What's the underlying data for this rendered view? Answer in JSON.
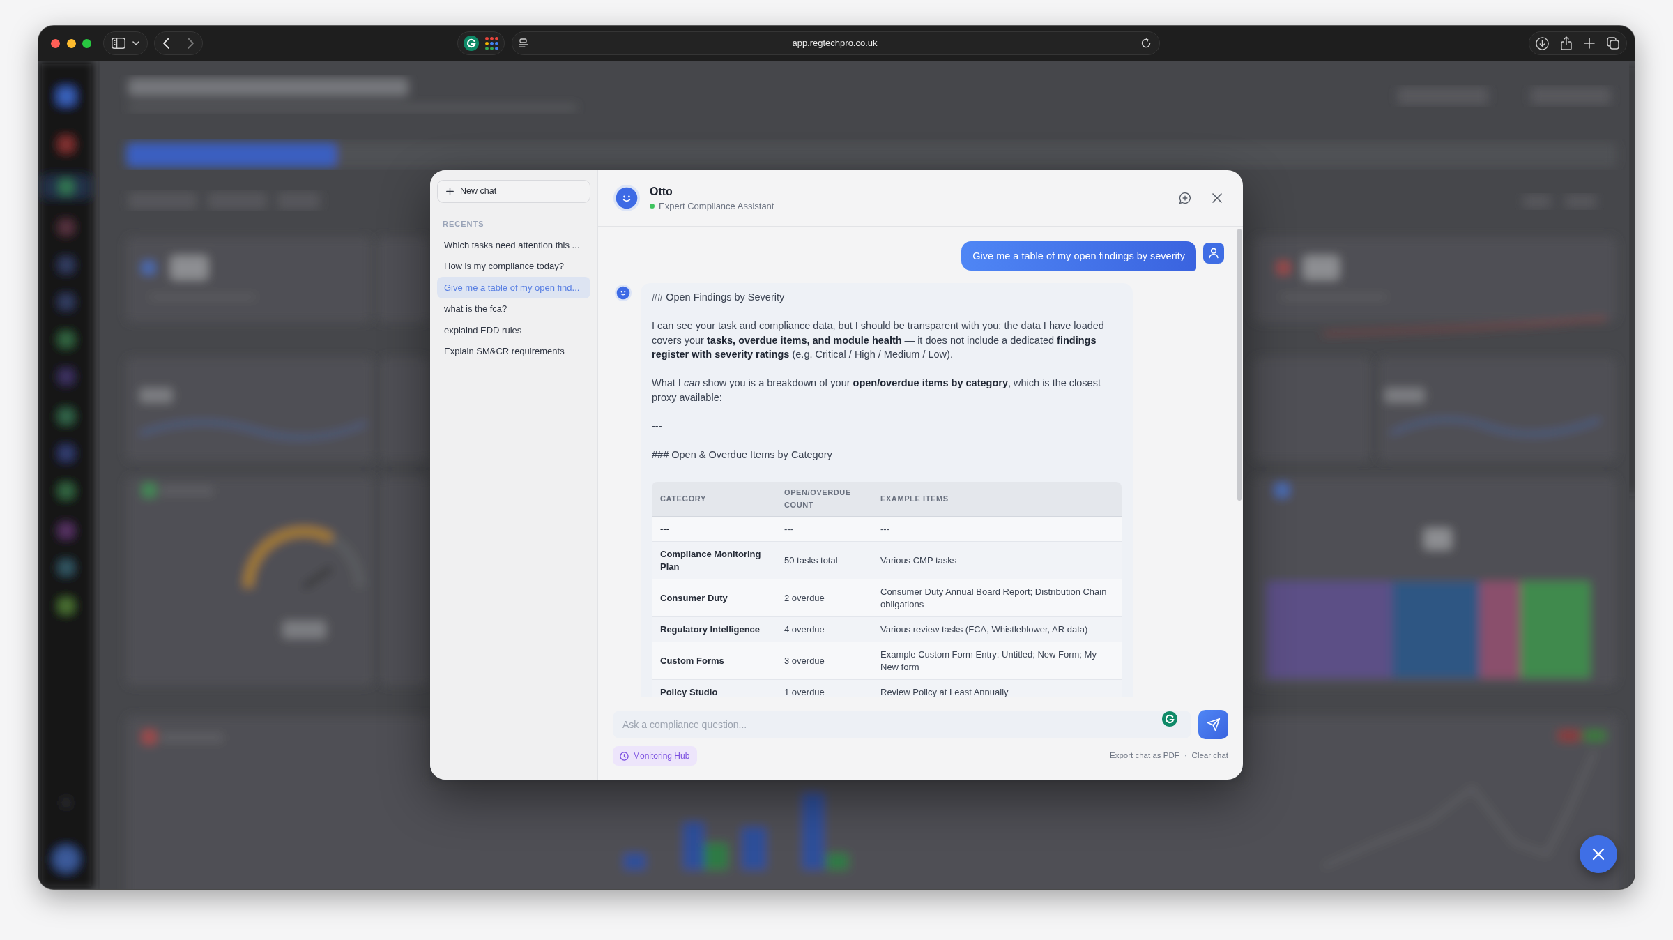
{
  "browser": {
    "url": "app.regtechpro.co.uk"
  },
  "chat": {
    "sidebar": {
      "new_chat": "New chat",
      "recents_label": "RECENTS",
      "recents": [
        {
          "title": "Which tasks need attention this ...",
          "selected": false
        },
        {
          "title": "How is my compliance today?",
          "selected": false
        },
        {
          "title": "Give me a table of my open find...",
          "selected": true
        },
        {
          "title": "what is the fca?",
          "selected": false
        },
        {
          "title": "explaind EDD rules",
          "selected": false
        },
        {
          "title": "Explain SM&CR requirements",
          "selected": false
        }
      ]
    },
    "header": {
      "name": "Otto",
      "subtitle": "Expert Compliance Assistant",
      "online": true
    },
    "messages": [
      {
        "kind": "user",
        "text": "Give me a table of my open findings by severity"
      },
      {
        "kind": "assistant",
        "blocks": [
          {
            "kind": "text",
            "text": "## Open Findings by Severity"
          },
          {
            "kind": "text",
            "text": "I can see your task and compliance data, but I should be transparent with you: the data I have loaded covers your **tasks, overdue items, and module health** — it does not include a dedicated **findings register with severity ratings** (e.g. Critical / High / Medium / Low)."
          },
          {
            "kind": "text",
            "text": "What I *can* show you is a breakdown of your **open/overdue items by category**, which is the closest proxy available:"
          },
          {
            "kind": "text",
            "text": "---"
          },
          {
            "kind": "text",
            "text": "### Open & Overdue Items by Category"
          },
          {
            "kind": "table",
            "columns": [
              "CATEGORY",
              "OPEN/OVERDUE COUNT",
              "EXAMPLE ITEMS"
            ],
            "rows": [
              [
                "---",
                "---",
                "---"
              ],
              [
                "Compliance Monitoring Plan",
                "50 tasks total",
                "Various CMP tasks"
              ],
              [
                "Consumer Duty",
                "2 overdue",
                "Consumer Duty Annual Board Report; Distribution Chain obligations"
              ],
              [
                "Regulatory Intelligence",
                "4 overdue",
                "Various review tasks (FCA, Whistleblower, AR data)"
              ],
              [
                "Custom Forms",
                "3 overdue",
                "Example Custom Form Entry; Untitled; New Form; My New form"
              ],
              [
                "Policy Studio",
                "1 overdue",
                "Review Policy at Least Annually"
              ]
            ]
          }
        ]
      }
    ],
    "composer": {
      "placeholder": "Ask a compliance question...",
      "context": "Monitoring Hub"
    },
    "footer": {
      "links": [
        "Export chat as PDF",
        "Clear chat"
      ],
      "separator": "·"
    }
  }
}
